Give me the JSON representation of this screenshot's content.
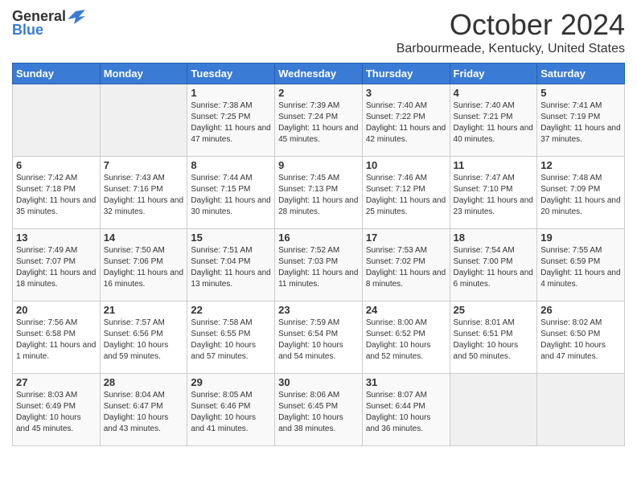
{
  "header": {
    "logo_general": "General",
    "logo_blue": "Blue",
    "month": "October 2024",
    "location": "Barbourmeade, Kentucky, United States"
  },
  "days_of_week": [
    "Sunday",
    "Monday",
    "Tuesday",
    "Wednesday",
    "Thursday",
    "Friday",
    "Saturday"
  ],
  "weeks": [
    [
      {
        "day": "",
        "sunrise": "",
        "sunset": "",
        "daylight": ""
      },
      {
        "day": "",
        "sunrise": "",
        "sunset": "",
        "daylight": ""
      },
      {
        "day": "1",
        "sunrise": "Sunrise: 7:38 AM",
        "sunset": "Sunset: 7:25 PM",
        "daylight": "Daylight: 11 hours and 47 minutes."
      },
      {
        "day": "2",
        "sunrise": "Sunrise: 7:39 AM",
        "sunset": "Sunset: 7:24 PM",
        "daylight": "Daylight: 11 hours and 45 minutes."
      },
      {
        "day": "3",
        "sunrise": "Sunrise: 7:40 AM",
        "sunset": "Sunset: 7:22 PM",
        "daylight": "Daylight: 11 hours and 42 minutes."
      },
      {
        "day": "4",
        "sunrise": "Sunrise: 7:40 AM",
        "sunset": "Sunset: 7:21 PM",
        "daylight": "Daylight: 11 hours and 40 minutes."
      },
      {
        "day": "5",
        "sunrise": "Sunrise: 7:41 AM",
        "sunset": "Sunset: 7:19 PM",
        "daylight": "Daylight: 11 hours and 37 minutes."
      }
    ],
    [
      {
        "day": "6",
        "sunrise": "Sunrise: 7:42 AM",
        "sunset": "Sunset: 7:18 PM",
        "daylight": "Daylight: 11 hours and 35 minutes."
      },
      {
        "day": "7",
        "sunrise": "Sunrise: 7:43 AM",
        "sunset": "Sunset: 7:16 PM",
        "daylight": "Daylight: 11 hours and 32 minutes."
      },
      {
        "day": "8",
        "sunrise": "Sunrise: 7:44 AM",
        "sunset": "Sunset: 7:15 PM",
        "daylight": "Daylight: 11 hours and 30 minutes."
      },
      {
        "day": "9",
        "sunrise": "Sunrise: 7:45 AM",
        "sunset": "Sunset: 7:13 PM",
        "daylight": "Daylight: 11 hours and 28 minutes."
      },
      {
        "day": "10",
        "sunrise": "Sunrise: 7:46 AM",
        "sunset": "Sunset: 7:12 PM",
        "daylight": "Daylight: 11 hours and 25 minutes."
      },
      {
        "day": "11",
        "sunrise": "Sunrise: 7:47 AM",
        "sunset": "Sunset: 7:10 PM",
        "daylight": "Daylight: 11 hours and 23 minutes."
      },
      {
        "day": "12",
        "sunrise": "Sunrise: 7:48 AM",
        "sunset": "Sunset: 7:09 PM",
        "daylight": "Daylight: 11 hours and 20 minutes."
      }
    ],
    [
      {
        "day": "13",
        "sunrise": "Sunrise: 7:49 AM",
        "sunset": "Sunset: 7:07 PM",
        "daylight": "Daylight: 11 hours and 18 minutes."
      },
      {
        "day": "14",
        "sunrise": "Sunrise: 7:50 AM",
        "sunset": "Sunset: 7:06 PM",
        "daylight": "Daylight: 11 hours and 16 minutes."
      },
      {
        "day": "15",
        "sunrise": "Sunrise: 7:51 AM",
        "sunset": "Sunset: 7:04 PM",
        "daylight": "Daylight: 11 hours and 13 minutes."
      },
      {
        "day": "16",
        "sunrise": "Sunrise: 7:52 AM",
        "sunset": "Sunset: 7:03 PM",
        "daylight": "Daylight: 11 hours and 11 minutes."
      },
      {
        "day": "17",
        "sunrise": "Sunrise: 7:53 AM",
        "sunset": "Sunset: 7:02 PM",
        "daylight": "Daylight: 11 hours and 8 minutes."
      },
      {
        "day": "18",
        "sunrise": "Sunrise: 7:54 AM",
        "sunset": "Sunset: 7:00 PM",
        "daylight": "Daylight: 11 hours and 6 minutes."
      },
      {
        "day": "19",
        "sunrise": "Sunrise: 7:55 AM",
        "sunset": "Sunset: 6:59 PM",
        "daylight": "Daylight: 11 hours and 4 minutes."
      }
    ],
    [
      {
        "day": "20",
        "sunrise": "Sunrise: 7:56 AM",
        "sunset": "Sunset: 6:58 PM",
        "daylight": "Daylight: 11 hours and 1 minute."
      },
      {
        "day": "21",
        "sunrise": "Sunrise: 7:57 AM",
        "sunset": "Sunset: 6:56 PM",
        "daylight": "Daylight: 10 hours and 59 minutes."
      },
      {
        "day": "22",
        "sunrise": "Sunrise: 7:58 AM",
        "sunset": "Sunset: 6:55 PM",
        "daylight": "Daylight: 10 hours and 57 minutes."
      },
      {
        "day": "23",
        "sunrise": "Sunrise: 7:59 AM",
        "sunset": "Sunset: 6:54 PM",
        "daylight": "Daylight: 10 hours and 54 minutes."
      },
      {
        "day": "24",
        "sunrise": "Sunrise: 8:00 AM",
        "sunset": "Sunset: 6:52 PM",
        "daylight": "Daylight: 10 hours and 52 minutes."
      },
      {
        "day": "25",
        "sunrise": "Sunrise: 8:01 AM",
        "sunset": "Sunset: 6:51 PM",
        "daylight": "Daylight: 10 hours and 50 minutes."
      },
      {
        "day": "26",
        "sunrise": "Sunrise: 8:02 AM",
        "sunset": "Sunset: 6:50 PM",
        "daylight": "Daylight: 10 hours and 47 minutes."
      }
    ],
    [
      {
        "day": "27",
        "sunrise": "Sunrise: 8:03 AM",
        "sunset": "Sunset: 6:49 PM",
        "daylight": "Daylight: 10 hours and 45 minutes."
      },
      {
        "day": "28",
        "sunrise": "Sunrise: 8:04 AM",
        "sunset": "Sunset: 6:47 PM",
        "daylight": "Daylight: 10 hours and 43 minutes."
      },
      {
        "day": "29",
        "sunrise": "Sunrise: 8:05 AM",
        "sunset": "Sunset: 6:46 PM",
        "daylight": "Daylight: 10 hours and 41 minutes."
      },
      {
        "day": "30",
        "sunrise": "Sunrise: 8:06 AM",
        "sunset": "Sunset: 6:45 PM",
        "daylight": "Daylight: 10 hours and 38 minutes."
      },
      {
        "day": "31",
        "sunrise": "Sunrise: 8:07 AM",
        "sunset": "Sunset: 6:44 PM",
        "daylight": "Daylight: 10 hours and 36 minutes."
      },
      {
        "day": "",
        "sunrise": "",
        "sunset": "",
        "daylight": ""
      },
      {
        "day": "",
        "sunrise": "",
        "sunset": "",
        "daylight": ""
      }
    ]
  ]
}
